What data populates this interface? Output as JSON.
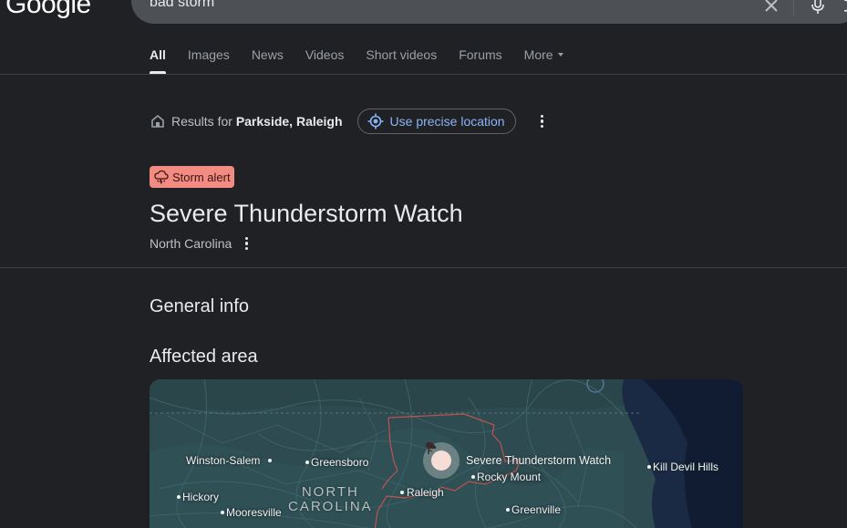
{
  "header": {
    "logo_text": "Google",
    "search_query": "bad storm"
  },
  "tabs": [
    {
      "label": "All",
      "active": true
    },
    {
      "label": "Images"
    },
    {
      "label": "News"
    },
    {
      "label": "Videos"
    },
    {
      "label": "Short videos"
    },
    {
      "label": "Forums"
    },
    {
      "label": "More"
    }
  ],
  "location": {
    "prefix": "Results for",
    "place": "Parkside, Raleigh",
    "precise_button": "Use precise location"
  },
  "alert": {
    "badge": "Storm alert",
    "title": "Severe Thunderstorm Watch",
    "region": "North Carolina",
    "badge_color": "#f28b82"
  },
  "sections": {
    "general_info": "General info",
    "affected_area": "Affected area"
  },
  "map": {
    "state_label": "NORTH\nCAROLINA",
    "watch_label": "Severe Thunderstorm Watch",
    "cities": [
      {
        "name": "Winston-Salem"
      },
      {
        "name": "Greensboro"
      },
      {
        "name": "Raleigh"
      },
      {
        "name": "Rocky Mount"
      },
      {
        "name": "Kill Devil Hills"
      },
      {
        "name": "Hickory"
      },
      {
        "name": "Mooresville"
      },
      {
        "name": "Greenville"
      }
    ]
  },
  "icons": {
    "clear": "close-icon",
    "mic": "mic-icon",
    "home": "home-icon",
    "locate": "crosshair-icon",
    "storm": "thunderstorm-icon",
    "more": "more-vert-icon"
  }
}
